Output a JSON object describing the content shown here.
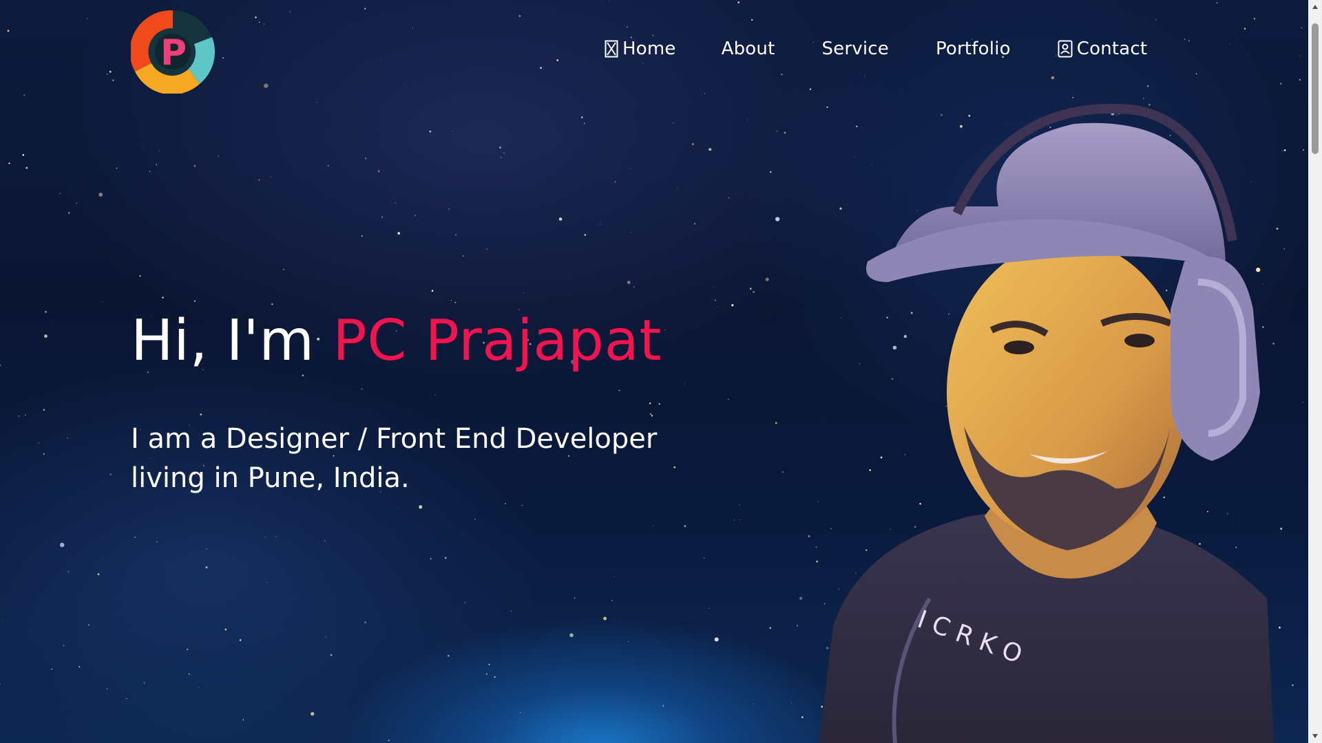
{
  "colors": {
    "accent": "#f2144f",
    "text": "#ffffff",
    "background": "#0b1633"
  },
  "nav": {
    "items": [
      {
        "label": "Home",
        "icon": "hourglass-icon"
      },
      {
        "label": "About"
      },
      {
        "label": "Service"
      },
      {
        "label": "Portfolio"
      },
      {
        "label": "Contact",
        "icon": "contact-card-icon"
      }
    ]
  },
  "hero": {
    "greeting": "Hi, I'm ",
    "name": "PC Prajapat",
    "description": "I am a Designer / Front End Developer living in Pune, India."
  },
  "logo": {
    "letter": "P"
  }
}
